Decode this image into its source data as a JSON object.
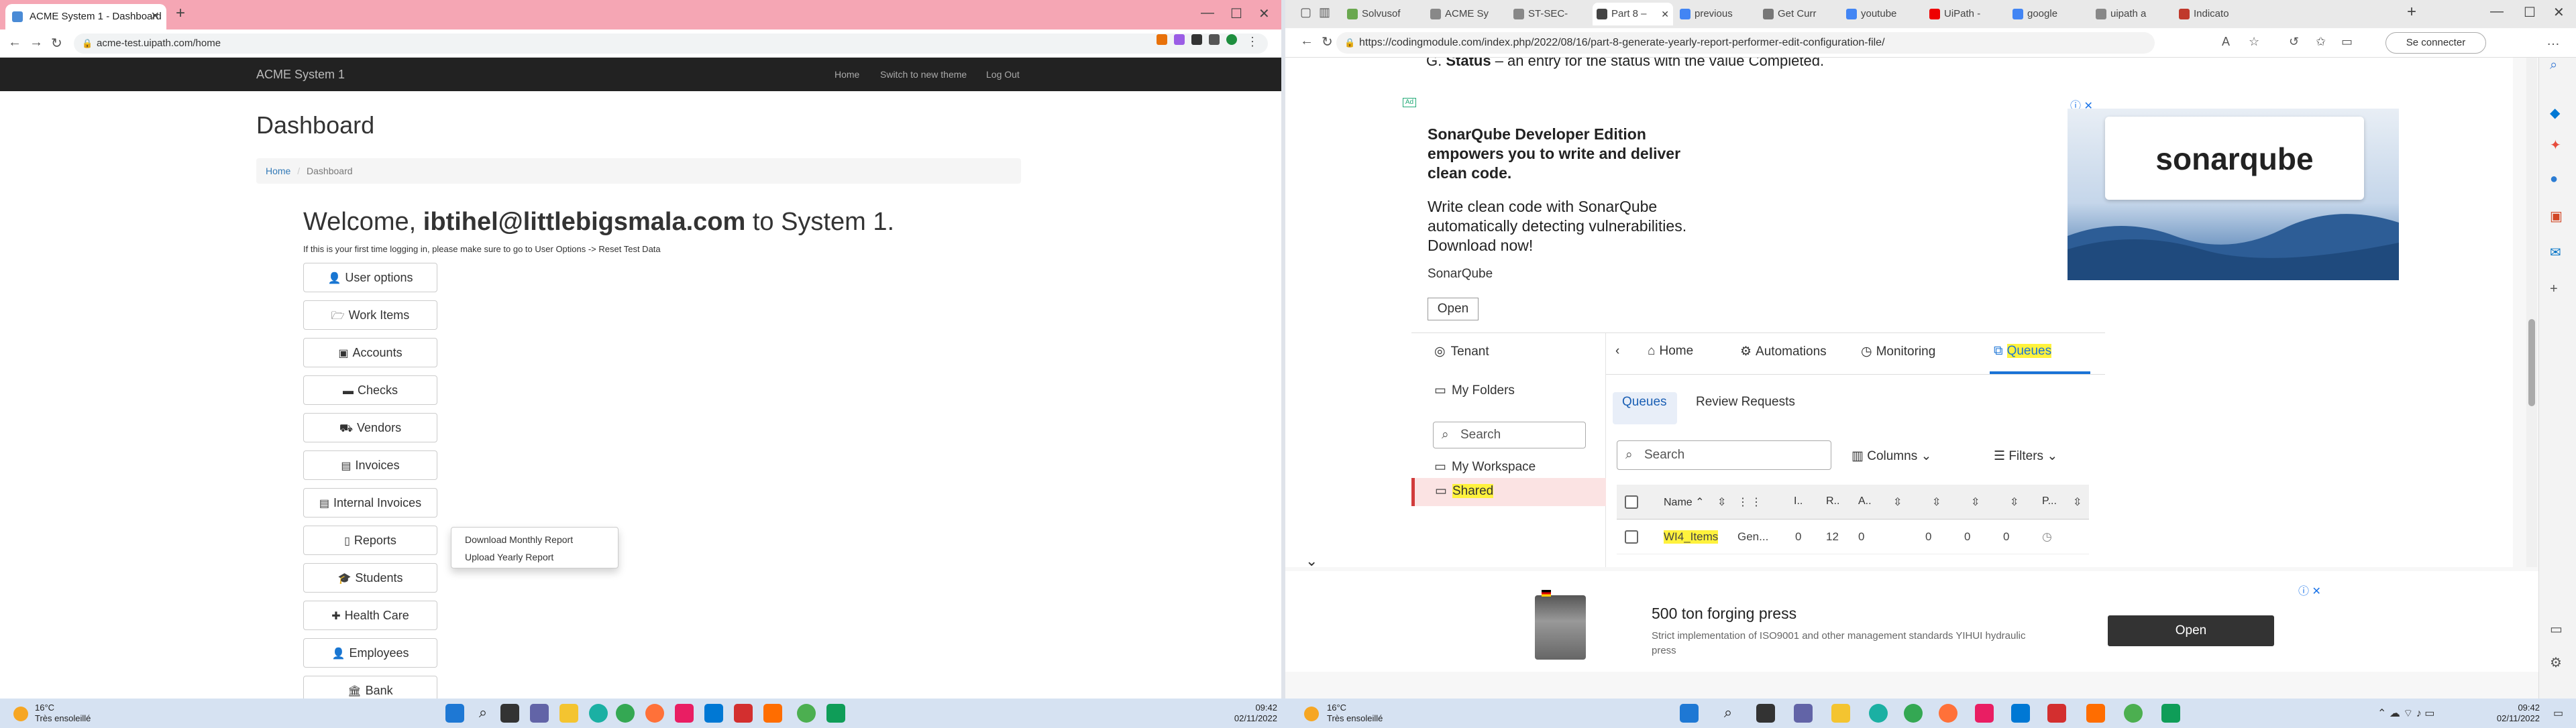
{
  "left_window": {
    "tab_title": "ACME System 1 - Dashboard",
    "url": "acme-test.uipath.com/home",
    "navbar": {
      "brand": "ACME System 1",
      "links": [
        "Home",
        "Switch to new theme",
        "Log Out"
      ]
    },
    "page_title": "Dashboard",
    "breadcrumb": {
      "home": "Home",
      "sep": "/",
      "current": "Dashboard"
    },
    "welcome": {
      "prefix": "Welcome, ",
      "email": "ibtihel@littlebigsmala.com",
      "suffix": " to System 1."
    },
    "hint": "If this is your first time logging in, please make sure to go to User Options -> Reset Test Data",
    "menu_buttons": [
      {
        "label": "User options",
        "icon": "user-icon"
      },
      {
        "label": "Work Items",
        "icon": "folder-icon"
      },
      {
        "label": "Accounts",
        "icon": "money-icon"
      },
      {
        "label": "Checks",
        "icon": "credit-card-icon"
      },
      {
        "label": "Vendors",
        "icon": "truck-icon"
      },
      {
        "label": "Invoices",
        "icon": "file-icon"
      },
      {
        "label": "Internal Invoices",
        "icon": "file-icon"
      },
      {
        "label": "Reports",
        "icon": "document-icon"
      },
      {
        "label": "Students",
        "icon": "graduation-cap-icon"
      },
      {
        "label": "Health Care",
        "icon": "medkit-icon"
      },
      {
        "label": "Employees",
        "icon": "user-icon"
      },
      {
        "label": "Bank",
        "icon": "bank-icon"
      }
    ],
    "reports_dropdown": [
      "Download Monthly Report",
      "Upload Yearly Report"
    ]
  },
  "right_window": {
    "tabs": [
      "Solvusof",
      "ACME Sy",
      "ST-SEC-",
      "Part 8 –",
      "previous",
      "Get Curr",
      "youtube",
      "UiPath -",
      "google",
      "uipath a",
      "Indicato"
    ],
    "active_tab": 3,
    "url": "https://codingmodule.com/index.php/2022/08/16/part-8-generate-yearly-report-performer-edit-configuration-file/",
    "connect_label": "Se connecter",
    "article_line": {
      "prefix": "G. ",
      "bold": "Status",
      "rest": " – an entry for the status with the value Completed."
    },
    "ad1": {
      "tag": "Ad",
      "title": "SonarQube Developer Edition empowers you to write and deliver clean code.",
      "body": "Write clean code with SonarQube automatically detecting vulnerabilities. Download now!",
      "advertiser": "SonarQube",
      "open_label": "Open",
      "logo_text": "sonarqube"
    },
    "uipath": {
      "sidebar": {
        "tenant": "Tenant",
        "my_folders": "My Folders",
        "search_placeholder": "Search",
        "my_workspace": "My Workspace",
        "shared": "Shared"
      },
      "topnav": [
        "Home",
        "Automations",
        "Monitoring",
        "Queues"
      ],
      "subtabs": [
        "Queues",
        "Review Requests"
      ],
      "search_placeholder": "Search",
      "columns_label": "Columns",
      "filters_label": "Filters",
      "table_headers": [
        "Name",
        "I..",
        "R..",
        "A..",
        "P..."
      ],
      "row": {
        "name": "WI4_Items",
        "desc": "Gen...",
        "v1": "0",
        "v2": "12",
        "v3": "0",
        "v4": "0",
        "v5": "0",
        "v6": "0"
      }
    },
    "ad2": {
      "title": "500 ton forging press",
      "body": "Strict implementation of ISO9001 and other management standards YIHUI hydraulic press",
      "open_label": "Open"
    }
  },
  "taskbar_left": {
    "temp": "16°C",
    "weather": "Très ensoleillé",
    "time": "09:42",
    "date": "02/11/2022"
  },
  "taskbar_right": {
    "temp": "16°C",
    "weather": "Très ensoleillé",
    "time": "09:42",
    "date": "02/11/2022"
  }
}
